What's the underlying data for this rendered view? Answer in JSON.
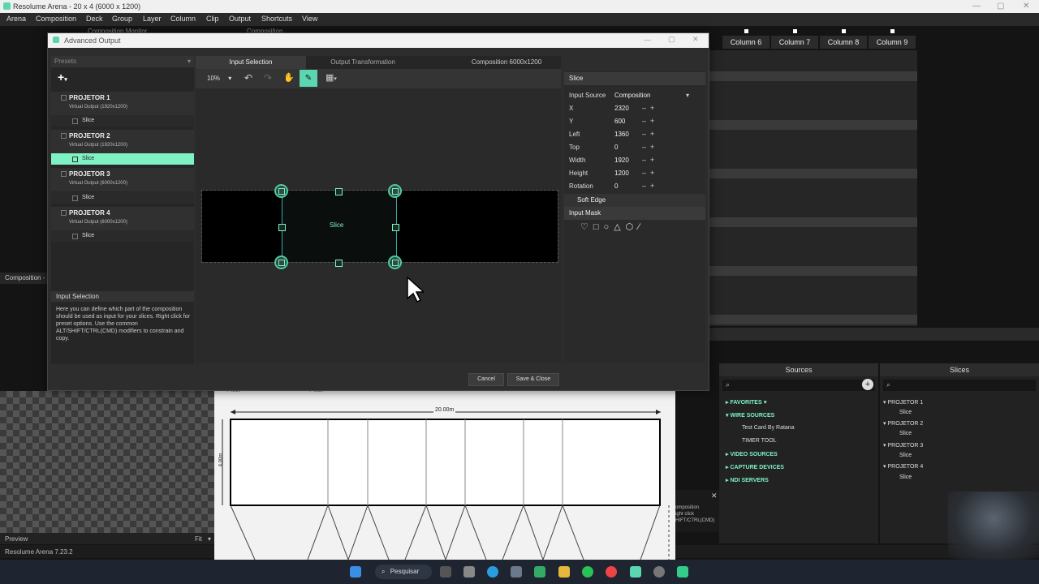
{
  "app": {
    "title": "Resolume Arena - 20 x 4 (6000 x 1200)",
    "menu": [
      "Arena",
      "Composition",
      "Deck",
      "Group",
      "Layer",
      "Column",
      "Clip",
      "Output",
      "Shortcuts",
      "View"
    ],
    "columns": [
      "Column 6",
      "Column 7",
      "Column 8",
      "Column 9"
    ],
    "composition_label": "Composition -",
    "preview_label": "Preview",
    "fit_label": "Fit",
    "version": "Resolume Arena 7.23.2",
    "bg_tab1": "Composition Monitor",
    "bg_tab2": "Composition"
  },
  "dialog": {
    "title": "Advanced Output",
    "presets_label": "Presets",
    "add_label": "+",
    "projectors": [
      {
        "name": "PROJETOR 1",
        "sub": "Virtual Output (1920x1200)",
        "slice": "Slice"
      },
      {
        "name": "PROJETOR 2",
        "sub": "Virtual Output (1920x1200)",
        "slice": "Slice"
      },
      {
        "name": "PROJETOR 3",
        "sub": "Virtual Output (6000x1200)",
        "slice": "Slice"
      },
      {
        "name": "PROJETOR 4",
        "sub": "Virtual Output (6000x1200)",
        "slice": "Slice"
      }
    ],
    "info_title": "Input Selection",
    "info_text": "Here you can define which part of the composition should be used as input for your slices. Right click for preset options. Use the common ALT/SHIFT/CTRL(CMD) modifiers to constrain and copy.",
    "tab_input": "Input Selection",
    "tab_output": "Output Transformation",
    "composition_size": "Composition 6000x1200",
    "zoom": "10%",
    "slice_label": "Slice",
    "cancel": "Cancel",
    "save_close": "Save & Close"
  },
  "properties": {
    "header": "Slice",
    "input_source_label": "Input Source",
    "input_source_value": "Composition",
    "rows": [
      {
        "k": "X",
        "v": "2320"
      },
      {
        "k": "Y",
        "v": "600"
      },
      {
        "k": "Left",
        "v": "1360"
      },
      {
        "k": "Top",
        "v": "0"
      },
      {
        "k": "Width",
        "v": "1920"
      },
      {
        "k": "Height",
        "v": "1200"
      },
      {
        "k": "Rotation",
        "v": "0"
      }
    ],
    "soft_edge": "Soft Edge",
    "input_mask": "Input Mask"
  },
  "doc": {
    "feet1": "feet",
    "feet2": "feet",
    "width_label": "20.00m",
    "height_label": "4.00m"
  },
  "sources": {
    "title": "Sources",
    "favorites": "FAVORITES",
    "wire": "WIRE SOURCES",
    "wire_items": [
      "Test Card By Ratana",
      "TIMER TOOL"
    ],
    "video": "VIDEO SOURCES",
    "capture": "CAPTURE DEVICES",
    "ndi": "NDI SERVERS"
  },
  "slices": {
    "title": "Slices",
    "items": [
      {
        "name": "PROJETOR 1",
        "slice": "Slice"
      },
      {
        "name": "PROJETOR 2",
        "slice": "Slice"
      },
      {
        "name": "PROJETOR 3",
        "slice": "Slice"
      },
      {
        "name": "PROJETOR 4",
        "slice": "Slice"
      }
    ]
  },
  "tooltip_fragment": "omposition\night click\nHIFT/CTRL(CMD)",
  "taskbar": {
    "search": "Pesquisar"
  },
  "colors": {
    "accent": "#7ff2c4",
    "handle": "#4fc9a0"
  }
}
